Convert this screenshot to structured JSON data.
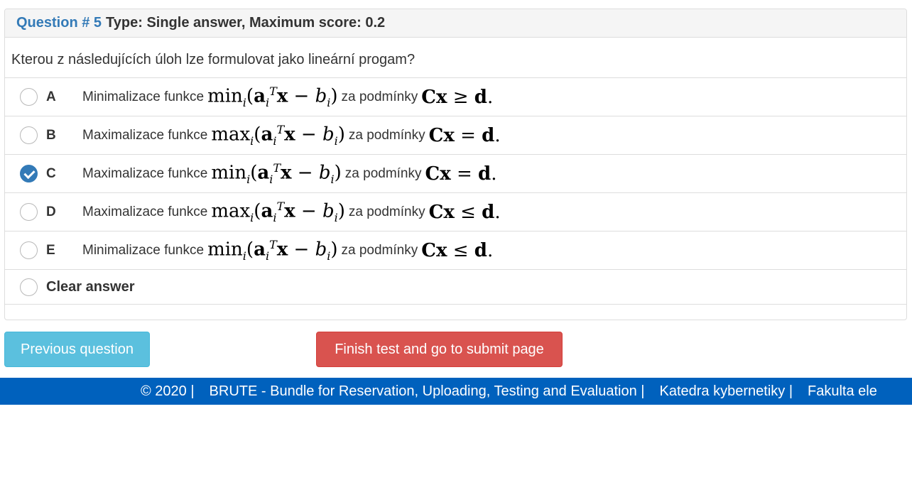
{
  "question": {
    "number_label": "Question # 5",
    "type_label": "Type: Single answer, Maximum score: 0.2",
    "text": "Kterou z následujících úloh lze formulovat jako lineární progam?"
  },
  "options": [
    {
      "letter": "A",
      "prefix": "Minimalizace funkce",
      "func": "min",
      "connector": "za podmínky",
      "rel": "≥",
      "selected": false
    },
    {
      "letter": "B",
      "prefix": "Maximalizace funkce",
      "func": "max",
      "connector": "za podmínky",
      "rel": "=",
      "selected": false
    },
    {
      "letter": "C",
      "prefix": "Maximalizace funkce",
      "func": "min",
      "connector": "za podmínky",
      "rel": "=",
      "selected": true
    },
    {
      "letter": "D",
      "prefix": "Maximalizace funkce",
      "func": "max",
      "connector": "za podmínky",
      "rel": "≤",
      "selected": false
    },
    {
      "letter": "E",
      "prefix": "Minimalizace funkce",
      "func": "min",
      "connector": "za podmínky",
      "rel": "≤",
      "selected": false
    }
  ],
  "clear_label": "Clear answer",
  "buttons": {
    "previous": "Previous question",
    "finish": "Finish test and go to submit page"
  },
  "footer": {
    "copyright": "© 2020 |",
    "app_name": "BRUTE - Bundle for Reservation, Uploading, Testing and Evaluation |",
    "department": "Katedra kybernetiky |",
    "faculty": "Fakulta ele"
  },
  "colors": {
    "accent": "#337ab7",
    "info_button": "#5bc0de",
    "danger_button": "#d9534f",
    "footer_bg": "#0061bd"
  }
}
